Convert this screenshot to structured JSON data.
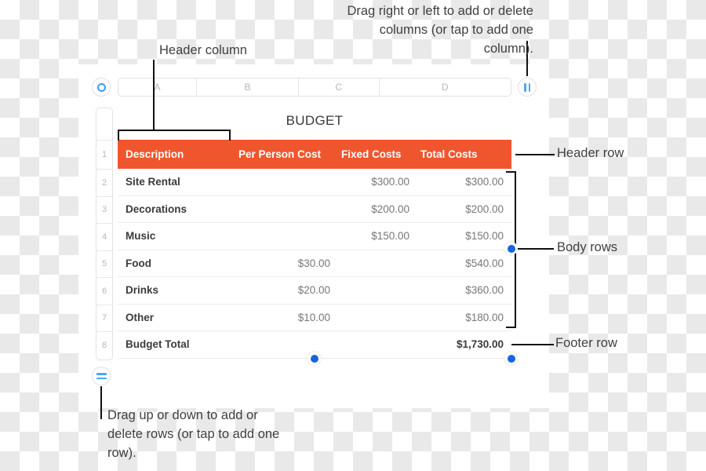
{
  "document": {
    "title": "BUDGET"
  },
  "column_bar": {
    "letters": [
      "A",
      "B",
      "C",
      "D"
    ]
  },
  "row_gutter": {
    "numbers": [
      "",
      "1",
      "2",
      "3",
      "4",
      "5",
      "6",
      "7",
      "8"
    ]
  },
  "handles": {
    "sheet_handle": "sheet-handle",
    "column_handle": "column-handle",
    "row_handle": "row-handle"
  },
  "table": {
    "header": {
      "description": "Description",
      "per_person_cost": "Per Person Cost",
      "fixed_costs": "Fixed Costs",
      "total_costs": "Total Costs"
    },
    "rows": [
      {
        "description": "Site Rental",
        "per_person": "",
        "fixed": "$300.00",
        "total": "$300.00"
      },
      {
        "description": "Decorations",
        "per_person": "",
        "fixed": "$200.00",
        "total": "$200.00"
      },
      {
        "description": "Music",
        "per_person": "",
        "fixed": "$150.00",
        "total": "$150.00"
      },
      {
        "description": "Food",
        "per_person": "$30.00",
        "fixed": "",
        "total": "$540.00"
      },
      {
        "description": "Drinks",
        "per_person": "$20.00",
        "fixed": "",
        "total": "$360.00"
      },
      {
        "description": "Other",
        "per_person": "$10.00",
        "fixed": "",
        "total": "$180.00"
      }
    ],
    "footer": {
      "description": "Budget Total",
      "per_person": "",
      "fixed": "",
      "total": "$1,730.00"
    }
  },
  "annotations": {
    "columns_note": "Drag right or left to add or delete columns (or tap to add one column).",
    "header_column": "Header column",
    "header_row": "Header row",
    "body_rows": "Body rows",
    "footer_row": "Footer row",
    "rows_note": "Drag up or down to add or delete rows (or tap to add one row)."
  },
  "colors": {
    "header_fill": "#F0562E",
    "accent_blue": "#1565e0",
    "handle_blue": "#4aa8f7"
  }
}
